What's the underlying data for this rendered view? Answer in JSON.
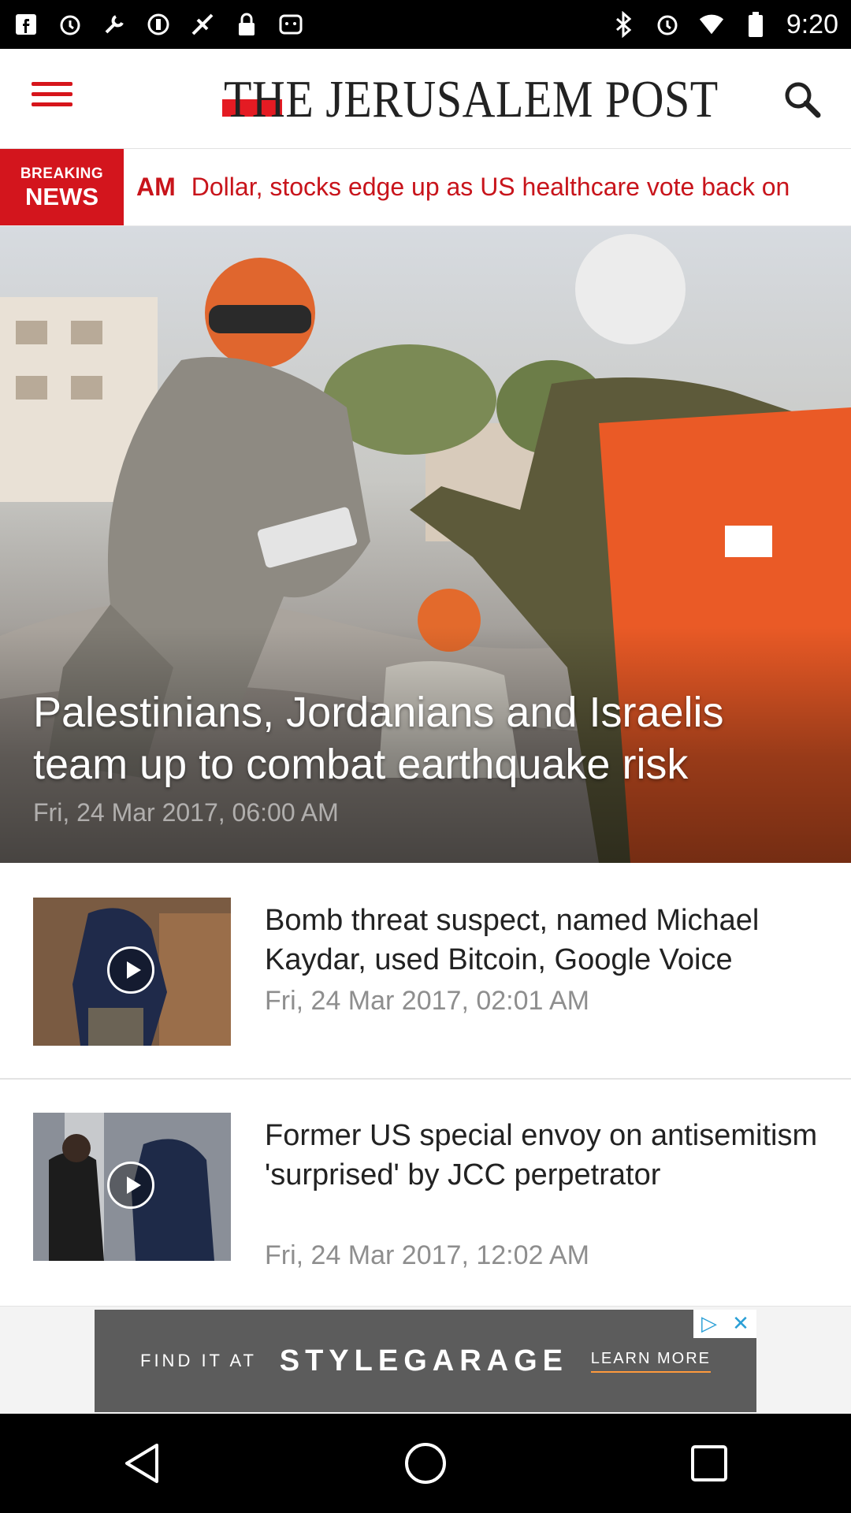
{
  "status_bar": {
    "time": "9:20",
    "left_icons": [
      "facebook-icon",
      "alarm-icon",
      "wrench-icon",
      "vpn-icon",
      "fake-gps-icon",
      "lock-icon",
      "android-icon"
    ],
    "right_icons": [
      "bluetooth-icon",
      "alarm-icon",
      "wifi-icon",
      "battery-icon"
    ]
  },
  "header": {
    "logo_text": "THE JERUSALEM POST",
    "brand_color": "#e41b23"
  },
  "breaking": {
    "badge_line1": "BREAKING",
    "badge_line2": "NEWS",
    "time": "AM",
    "headline": "Dollar, stocks edge up as US healthcare vote back on"
  },
  "hero": {
    "title": "Palestinians, Jordanians and Israelis team up to combat earthquake risk",
    "date": "Fri, 24 Mar 2017, 06:00 AM"
  },
  "articles": [
    {
      "title": "Bomb threat suspect, named Michael Kaydar, used Bitcoin, Google Voice",
      "date": "Fri, 24 Mar 2017, 02:01 AM"
    },
    {
      "title": "Former US special envoy on antisemitism 'surprised' by JCC perpetrator",
      "date": "Fri, 24 Mar 2017, 12:02 AM"
    }
  ],
  "ad": {
    "left_text": "FIND IT AT",
    "brand": "STYLEGARAGE",
    "cta": "LEARN MORE"
  }
}
